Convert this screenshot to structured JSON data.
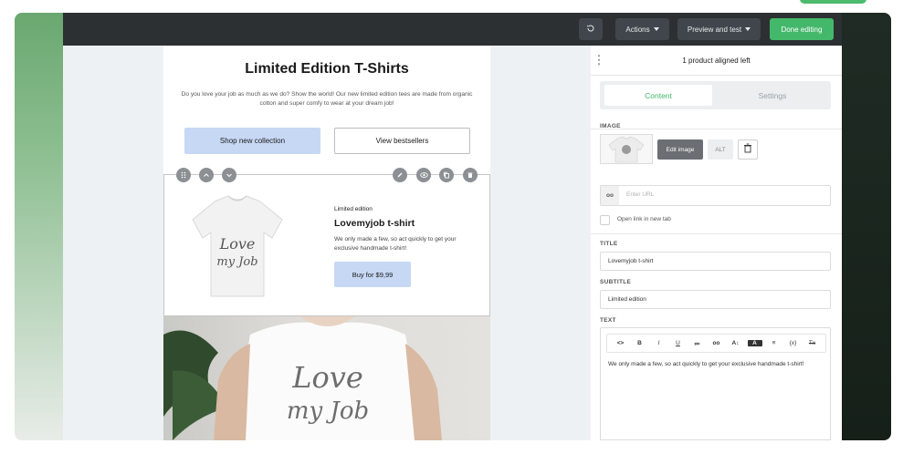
{
  "colors": {
    "accent_green": "#43b86a",
    "toolbar_bg": "#2c3033",
    "button_blue": "#c7d8f5"
  },
  "toolbar": {
    "history_icon": "history-icon",
    "actions_label": "Actions",
    "preview_label": "Preview and test",
    "done_label": "Done editing"
  },
  "email": {
    "title": "Limited Edition T-Shirts",
    "intro": "Do you love your job as much as we do? Show the world! Our new limited edition tees are made from organic cotton and super comfy to wear at your dream job!",
    "primary_button": "Shop new collection",
    "secondary_button": "View bestsellers",
    "shirt_print_top": "Love",
    "shirt_print_bottom": "my Job",
    "product": {
      "label": "Limited edition",
      "title": "Lovemyjob t-shirt",
      "text": "We only made a few, so act quickly to get your exclusive handmade t-shirt!",
      "buy_button": "Buy for $9,99"
    }
  },
  "panel": {
    "header": "1 product aligned left",
    "tabs": [
      "Content",
      "Settings"
    ],
    "image_label": "IMAGE",
    "edit_image": "Edit image",
    "alt": "ALT",
    "url_icon": "oo",
    "url_placeholder": "Enter URL",
    "open_new_tab": "Open link in new tab",
    "title_label": "TITLE",
    "title_value": "Lovemyjob t-shirt",
    "subtitle_label": "SUBTITLE",
    "subtitle_value": "Limited edition",
    "text_label": "TEXT",
    "editor_tools": [
      "<>",
      "B",
      "I",
      "U",
      "≔",
      "oo",
      "A↕",
      "A",
      "≡",
      "{x}",
      "Tx"
    ],
    "text_value": "We only made a few, so act quickly to get your exclusive handmade t-shirt!"
  }
}
